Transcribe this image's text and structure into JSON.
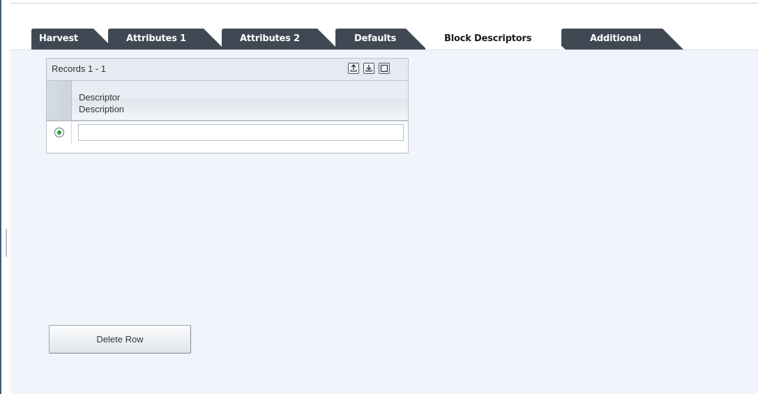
{
  "tabs": [
    {
      "label": "Harvest",
      "active": false
    },
    {
      "label": "Attributes 1",
      "active": false
    },
    {
      "label": "Attributes 2",
      "active": false
    },
    {
      "label": "Defaults",
      "active": false
    },
    {
      "label": "Block Descriptors",
      "active": true
    },
    {
      "label": "Additional",
      "active": false
    }
  ],
  "grid": {
    "records_label": "Records 1 - 1",
    "toolbar_icons": [
      "export-icon",
      "import-icon",
      "maximize-icon"
    ],
    "column_header": {
      "line1": "Descriptor",
      "line2": "Description"
    },
    "rows": [
      {
        "selected": true,
        "descriptor": ""
      }
    ]
  },
  "buttons": {
    "delete_row": "Delete Row"
  },
  "colors": {
    "tab_dark": "#3f4853",
    "tab_active": "#ffffff",
    "panel_background": "#f1f5fb",
    "radio_selected": "#2f9a35"
  }
}
